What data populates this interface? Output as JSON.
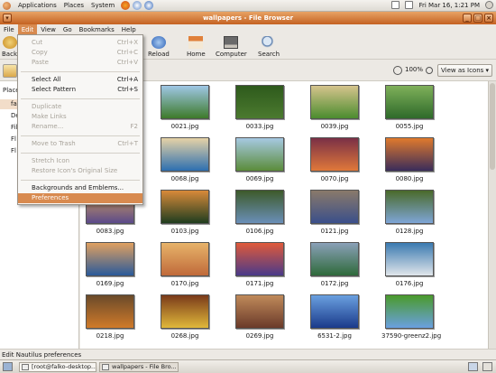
{
  "top_panel": {
    "menus": [
      "Applications",
      "Places",
      "System"
    ],
    "clock": "Fri Mar 16,  1:21 PM"
  },
  "window": {
    "title": "wallpapers - File Browser"
  },
  "menubar": [
    "File",
    "Edit",
    "View",
    "Go",
    "Bookmarks",
    "Help"
  ],
  "toolbar": {
    "back": "Back",
    "reload": "Reload",
    "home": "Home",
    "computer": "Computer",
    "search": "Search"
  },
  "location": {
    "zoom": "100%",
    "view_as": "View as Icons"
  },
  "sidepane": {
    "header": "Places",
    "items": [
      "fal",
      "De",
      "Fil",
      "Fl",
      "Fl"
    ]
  },
  "edit_menu": {
    "cut": "Cut",
    "cut_acc": "Ctrl+X",
    "copy": "Copy",
    "copy_acc": "Ctrl+C",
    "paste": "Paste",
    "paste_acc": "Ctrl+V",
    "select_all": "Select All",
    "select_all_acc": "Ctrl+A",
    "select_pattern": "Select Pattern",
    "select_pattern_acc": "Ctrl+S",
    "duplicate": "Duplicate",
    "make_links": "Make Links",
    "rename": "Rename...",
    "rename_acc": "F2",
    "move_to_trash": "Move to Trash",
    "move_to_trash_acc": "Ctrl+T",
    "stretch_icon": "Stretch Icon",
    "restore_icon": "Restore Icon's Original Size",
    "backgrounds": "Backgrounds and Emblems...",
    "preferences": "Preferences"
  },
  "files": [
    {
      "name": "0021.jpg",
      "color_a": "#3d7a2a",
      "color_b": "#9fc7e6"
    },
    {
      "name": "0033.jpg",
      "color_a": "#4b7a2f",
      "color_b": "#2e5a1c"
    },
    {
      "name": "0039.jpg",
      "color_a": "#4b8c2e",
      "color_b": "#d6c48d"
    },
    {
      "name": "0055.jpg",
      "color_a": "#2e6a2a",
      "color_b": "#7fb05a"
    },
    {
      "name": "0068.jpg",
      "color_a": "#2d6fb0",
      "color_b": "#e6d2a6"
    },
    {
      "name": "0069.jpg",
      "color_a": "#5b8c3a",
      "color_b": "#a6c9e2"
    },
    {
      "name": "0070.jpg",
      "color_a": "#e0783a",
      "color_b": "#7a3046"
    },
    {
      "name": "0080.jpg",
      "color_a": "#3a2c5a",
      "color_b": "#e07a2d"
    },
    {
      "name": "0083.jpg",
      "color_a": "#5b4a8a",
      "color_b": "#d9a35a"
    },
    {
      "name": "0103.jpg",
      "color_a": "#1f3d1f",
      "color_b": "#d98a3a"
    },
    {
      "name": "0106.jpg",
      "color_a": "#6a8fb8",
      "color_b": "#3d5a2a"
    },
    {
      "name": "0121.jpg",
      "color_a": "#3a4f8a",
      "color_b": "#8a7a6a"
    },
    {
      "name": "0128.jpg",
      "color_a": "#7ea5d6",
      "color_b": "#4a6a2a"
    },
    {
      "name": "0169.jpg",
      "color_a": "#2a5a9a",
      "color_b": "#e0a060"
    },
    {
      "name": "0170.jpg",
      "color_a": "#c06a3a",
      "color_b": "#e7b36a"
    },
    {
      "name": "0171.jpg",
      "color_a": "#4a3a8a",
      "color_b": "#e05a3a"
    },
    {
      "name": "0172.jpg",
      "color_a": "#2e6a3a",
      "color_b": "#8aa0b8"
    },
    {
      "name": "0176.jpg",
      "color_a": "#e0e6ea",
      "color_b": "#3a7ab0"
    },
    {
      "name": "0218.jpg",
      "color_a": "#d07a2a",
      "color_b": "#6a4a2a"
    },
    {
      "name": "0268.jpg",
      "color_a": "#e0b83a",
      "color_b": "#7a3a1a"
    },
    {
      "name": "0269.jpg",
      "color_a": "#6a3a2a",
      "color_b": "#c08a5a"
    },
    {
      "name": "6531-2.jpg",
      "color_a": "#1a3a8a",
      "color_b": "#6aa0e0"
    },
    {
      "name": "37590-greenz2.jpg",
      "color_a": "#6aa0e0",
      "color_b": "#4a9a2a"
    }
  ],
  "statusbar": "Edit Nautilus preferences",
  "taskbar": [
    "[root@falko-desktop...",
    "wallpapers - File Bro..."
  ],
  "colors": {
    "accent": "#d88a4f",
    "titlebar": "#c46222"
  }
}
